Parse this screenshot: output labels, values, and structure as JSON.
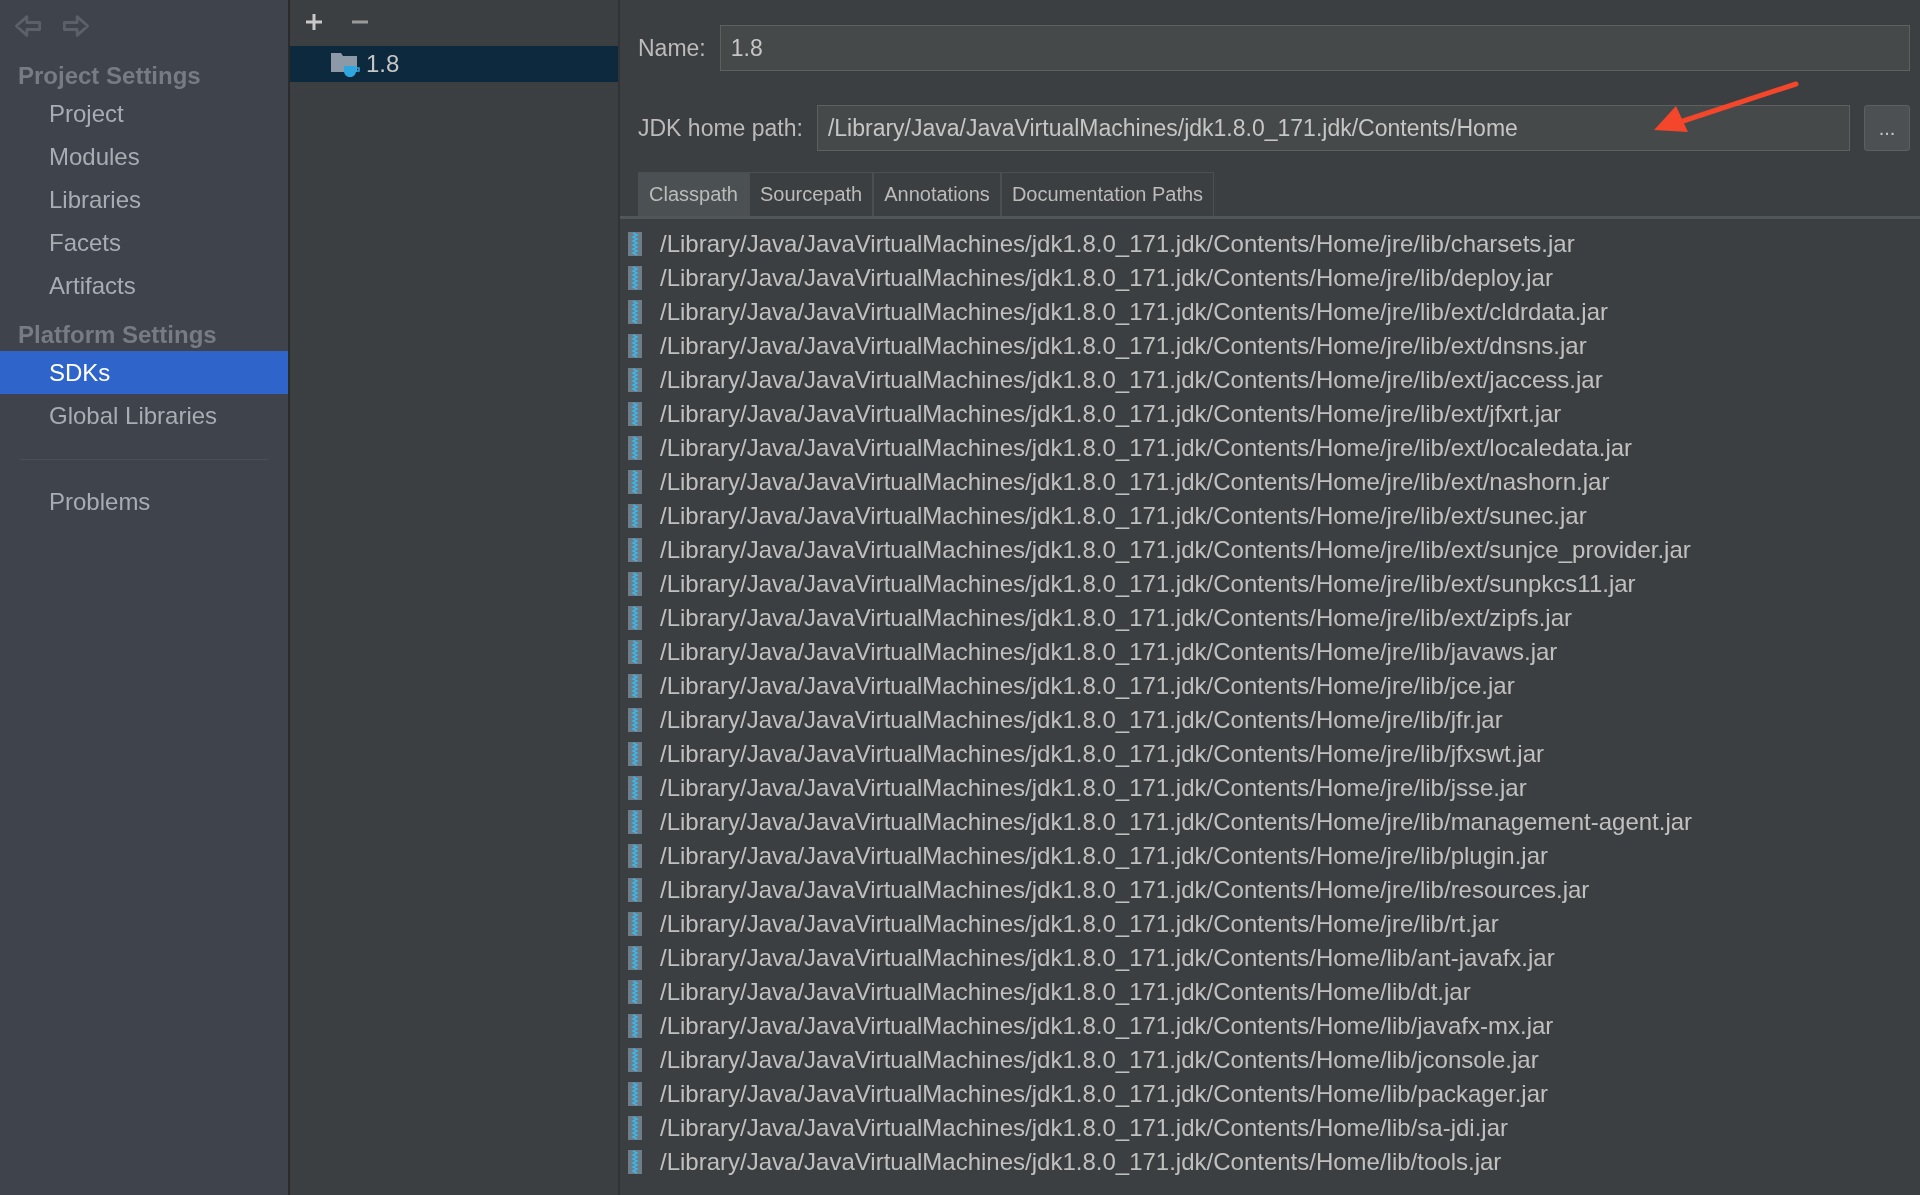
{
  "navigation": {
    "back_disabled": true,
    "forward_disabled": true
  },
  "sidebar": {
    "sections": [
      {
        "title": "Project Settings",
        "items": [
          {
            "label": "Project",
            "selected": false
          },
          {
            "label": "Modules",
            "selected": false
          },
          {
            "label": "Libraries",
            "selected": false
          },
          {
            "label": "Facets",
            "selected": false
          },
          {
            "label": "Artifacts",
            "selected": false
          }
        ]
      },
      {
        "title": "Platform Settings",
        "items": [
          {
            "label": "SDKs",
            "selected": true
          },
          {
            "label": "Global Libraries",
            "selected": false
          }
        ]
      }
    ],
    "footer_items": [
      {
        "label": "Problems",
        "selected": false
      }
    ]
  },
  "sdk_list": {
    "items": [
      {
        "label": "1.8",
        "selected": true
      }
    ]
  },
  "form": {
    "name_label": "Name:",
    "name_value": "1.8",
    "home_label": "JDK home path:",
    "home_value": "/Library/Java/JavaVirtualMachines/jdk1.8.0_171.jdk/Contents/Home",
    "browse_label": "...",
    "annotation_arrow": true
  },
  "tabs": [
    {
      "label": "Classpath",
      "selected": true
    },
    {
      "label": "Sourcepath",
      "selected": false
    },
    {
      "label": "Annotations",
      "selected": false
    },
    {
      "label": "Documentation Paths",
      "selected": false
    }
  ],
  "classpath": [
    "/Library/Java/JavaVirtualMachines/jdk1.8.0_171.jdk/Contents/Home/jre/lib/charsets.jar",
    "/Library/Java/JavaVirtualMachines/jdk1.8.0_171.jdk/Contents/Home/jre/lib/deploy.jar",
    "/Library/Java/JavaVirtualMachines/jdk1.8.0_171.jdk/Contents/Home/jre/lib/ext/cldrdata.jar",
    "/Library/Java/JavaVirtualMachines/jdk1.8.0_171.jdk/Contents/Home/jre/lib/ext/dnsns.jar",
    "/Library/Java/JavaVirtualMachines/jdk1.8.0_171.jdk/Contents/Home/jre/lib/ext/jaccess.jar",
    "/Library/Java/JavaVirtualMachines/jdk1.8.0_171.jdk/Contents/Home/jre/lib/ext/jfxrt.jar",
    "/Library/Java/JavaVirtualMachines/jdk1.8.0_171.jdk/Contents/Home/jre/lib/ext/localedata.jar",
    "/Library/Java/JavaVirtualMachines/jdk1.8.0_171.jdk/Contents/Home/jre/lib/ext/nashorn.jar",
    "/Library/Java/JavaVirtualMachines/jdk1.8.0_171.jdk/Contents/Home/jre/lib/ext/sunec.jar",
    "/Library/Java/JavaVirtualMachines/jdk1.8.0_171.jdk/Contents/Home/jre/lib/ext/sunjce_provider.jar",
    "/Library/Java/JavaVirtualMachines/jdk1.8.0_171.jdk/Contents/Home/jre/lib/ext/sunpkcs11.jar",
    "/Library/Java/JavaVirtualMachines/jdk1.8.0_171.jdk/Contents/Home/jre/lib/ext/zipfs.jar",
    "/Library/Java/JavaVirtualMachines/jdk1.8.0_171.jdk/Contents/Home/jre/lib/javaws.jar",
    "/Library/Java/JavaVirtualMachines/jdk1.8.0_171.jdk/Contents/Home/jre/lib/jce.jar",
    "/Library/Java/JavaVirtualMachines/jdk1.8.0_171.jdk/Contents/Home/jre/lib/jfr.jar",
    "/Library/Java/JavaVirtualMachines/jdk1.8.0_171.jdk/Contents/Home/jre/lib/jfxswt.jar",
    "/Library/Java/JavaVirtualMachines/jdk1.8.0_171.jdk/Contents/Home/jre/lib/jsse.jar",
    "/Library/Java/JavaVirtualMachines/jdk1.8.0_171.jdk/Contents/Home/jre/lib/management-agent.jar",
    "/Library/Java/JavaVirtualMachines/jdk1.8.0_171.jdk/Contents/Home/jre/lib/plugin.jar",
    "/Library/Java/JavaVirtualMachines/jdk1.8.0_171.jdk/Contents/Home/jre/lib/resources.jar",
    "/Library/Java/JavaVirtualMachines/jdk1.8.0_171.jdk/Contents/Home/jre/lib/rt.jar",
    "/Library/Java/JavaVirtualMachines/jdk1.8.0_171.jdk/Contents/Home/lib/ant-javafx.jar",
    "/Library/Java/JavaVirtualMachines/jdk1.8.0_171.jdk/Contents/Home/lib/dt.jar",
    "/Library/Java/JavaVirtualMachines/jdk1.8.0_171.jdk/Contents/Home/lib/javafx-mx.jar",
    "/Library/Java/JavaVirtualMachines/jdk1.8.0_171.jdk/Contents/Home/lib/jconsole.jar",
    "/Library/Java/JavaVirtualMachines/jdk1.8.0_171.jdk/Contents/Home/lib/packager.jar",
    "/Library/Java/JavaVirtualMachines/jdk1.8.0_171.jdk/Contents/Home/lib/sa-jdi.jar",
    "/Library/Java/JavaVirtualMachines/jdk1.8.0_171.jdk/Contents/Home/lib/tools.jar"
  ]
}
